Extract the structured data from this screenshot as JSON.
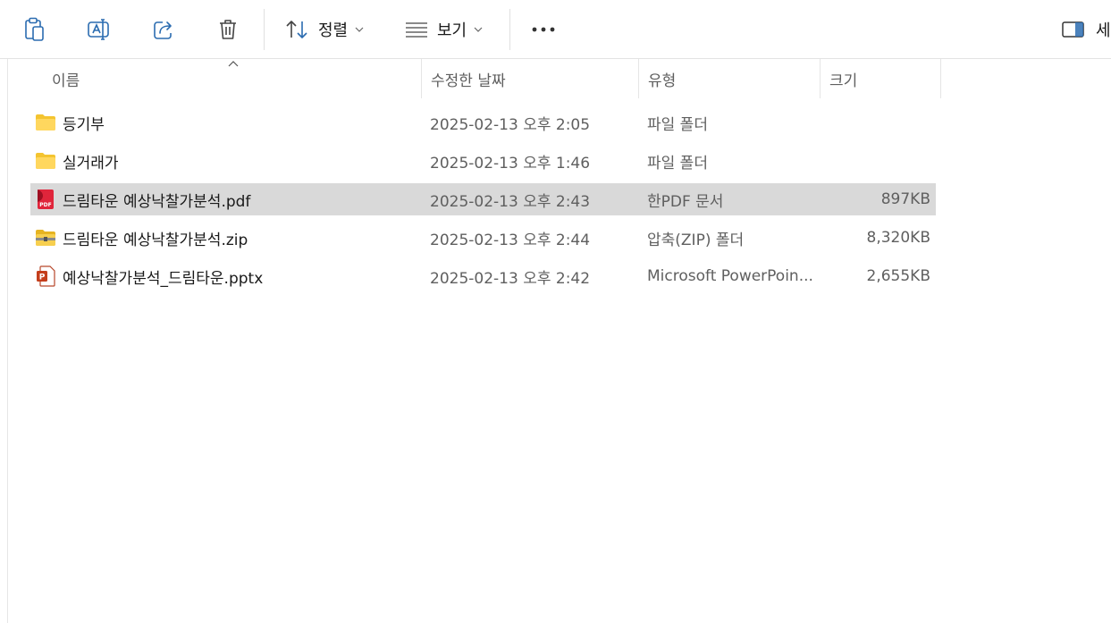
{
  "toolbar": {
    "sort_label": "정렬",
    "view_label": "보기",
    "details_label": "세"
  },
  "columns": {
    "name": "이름",
    "date": "수정한 날짜",
    "type": "유형",
    "size": "크기"
  },
  "files": [
    {
      "name": "등기부",
      "date": "2025-02-13 오후 2:05",
      "type": "파일 폴더",
      "size": "",
      "icon": "folder-icon",
      "selected": false
    },
    {
      "name": "실거래가",
      "date": "2025-02-13 오후 1:46",
      "type": "파일 폴더",
      "size": "",
      "icon": "folder-icon",
      "selected": false
    },
    {
      "name": "드림타운 예상낙찰가분석.pdf",
      "date": "2025-02-13 오후 2:43",
      "type": "한PDF 문서",
      "size": "897KB",
      "icon": "pdf-file-icon",
      "selected": true
    },
    {
      "name": "드림타운 예상낙찰가분석.zip",
      "date": "2025-02-13 오후 2:44",
      "type": "압축(ZIP) 폴더",
      "size": "8,320KB",
      "icon": "zip-folder-icon",
      "selected": false
    },
    {
      "name": "예상낙찰가분석_드림타운.pptx",
      "date": "2025-02-13 오후 2:42",
      "type": "Microsoft PowerPoin...",
      "size": "2,655KB",
      "icon": "pptx-file-icon",
      "selected": false
    }
  ]
}
